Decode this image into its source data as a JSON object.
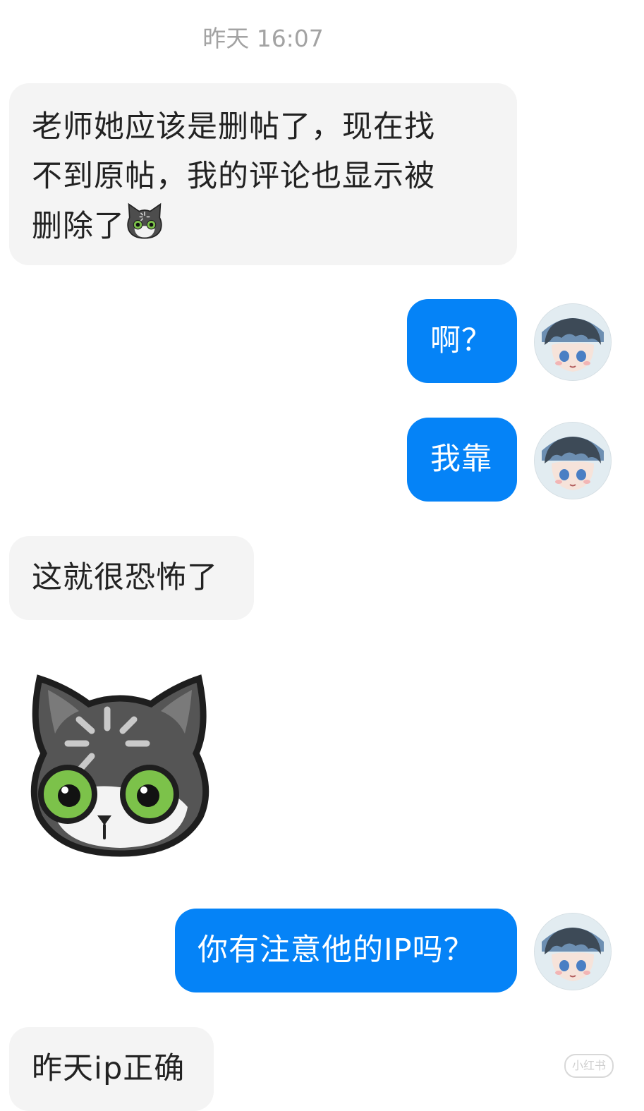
{
  "chat": {
    "timestamp": "昨天 16:07",
    "messages": [
      {
        "from": "other",
        "text": "老师她应该是删帖了，现在找不到原帖，我的评论也显示被删除了",
        "emoji": "cat-loading-emoji"
      },
      {
        "from": "me",
        "text": "啊？"
      },
      {
        "from": "me",
        "text": "我靠"
      },
      {
        "from": "other",
        "text": "这就很恐怖了"
      },
      {
        "from": "other",
        "sticker": "cat-loading-sticker"
      },
      {
        "from": "me",
        "text": "你有注意他的IP吗？"
      },
      {
        "from": "other",
        "text": "昨天ip正确"
      }
    ]
  },
  "lines": {
    "m1_l1": "老师她应该是删帖了，现在找",
    "m1_l2": "不到原帖，我的评论也显示被",
    "m1_l3": "删除了"
  },
  "watermark": "小红书",
  "colors": {
    "outgoing_bubble": "#0583f7",
    "incoming_bubble": "#f4f4f4",
    "timestamp": "#a3a3a3",
    "cat_eye": "#7cc24a"
  }
}
